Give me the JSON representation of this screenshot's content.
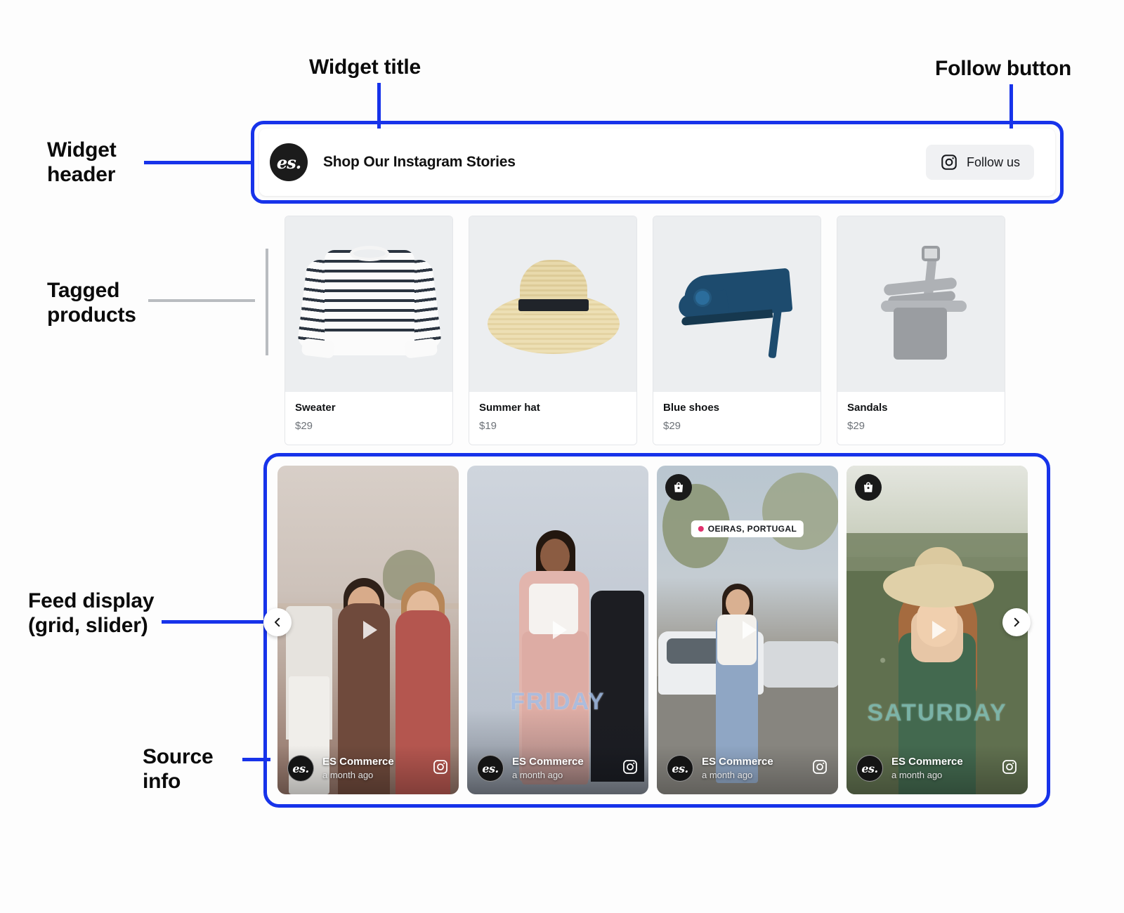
{
  "annotations": {
    "widget_title": "Widget title",
    "follow_button": "Follow button",
    "widget_header": "Widget\nheader",
    "tagged_products": "Tagged\nproducts",
    "feed_display": "Feed display\n(grid, slider)",
    "source_info": "Source\ninfo"
  },
  "colors": {
    "accent_blue": "#1733ea",
    "connector_gray": "#b9bcc0",
    "logo_dark": "#1b1b1b",
    "instagram_pink": "#e1306c"
  },
  "header": {
    "logo_text": "es.",
    "logo_icon": "es-brand-logo",
    "title": "Shop Our Instagram Stories",
    "follow_button": {
      "label": "Follow us",
      "icon": "instagram-icon"
    }
  },
  "products": [
    {
      "name": "Sweater",
      "price": "$29",
      "image": "striped-sweater-image"
    },
    {
      "name": "Summer hat",
      "price": "$19",
      "image": "straw-hat-image"
    },
    {
      "name": "Blue shoes",
      "price": "$29",
      "image": "blue-heel-shoe-image"
    },
    {
      "name": "Sandals",
      "price": "$29",
      "image": "grey-sandal-image"
    }
  ],
  "feed": {
    "prev_icon": "chevron-left-icon",
    "next_icon": "chevron-right-icon",
    "play_icon": "play-icon",
    "bag_icon": "shopping-bag-icon",
    "instagram_icon": "instagram-icon",
    "cards": [
      {
        "source_name": "ES Commerce",
        "timestamp": "a month ago",
        "avatar_text": "es.",
        "has_bag_badge": false,
        "location": null,
        "overlay_text": null
      },
      {
        "source_name": "ES Commerce",
        "timestamp": "a month ago",
        "avatar_text": "es.",
        "has_bag_badge": false,
        "location": null,
        "overlay_text": "FRIDAY"
      },
      {
        "source_name": "ES Commerce",
        "timestamp": "a month ago",
        "avatar_text": "es.",
        "has_bag_badge": true,
        "location": "OEIRAS, PORTUGAL",
        "overlay_text": null
      },
      {
        "source_name": "ES Commerce",
        "timestamp": "a month ago",
        "avatar_text": "es.",
        "has_bag_badge": true,
        "location": null,
        "overlay_text": "SATURDAY"
      }
    ]
  }
}
